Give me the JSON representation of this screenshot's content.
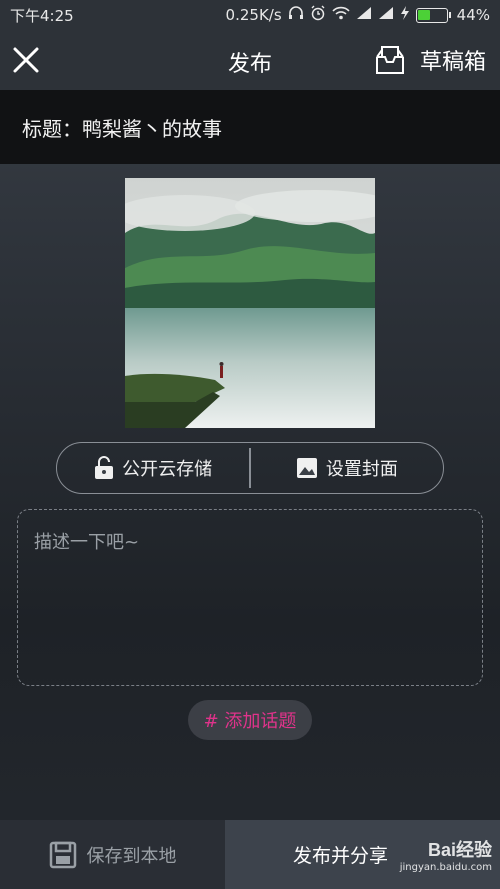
{
  "status_bar": {
    "time": "下午4:25",
    "speed": "0.25K/s",
    "battery_percent": "44%",
    "battery_level": 0.44,
    "icons": [
      "headphones-icon",
      "alarm-icon",
      "wifi-icon",
      "signal-icon",
      "signal-icon",
      "charging-icon",
      "battery-icon"
    ]
  },
  "header": {
    "title": "发布",
    "drafts_label": "草稿箱"
  },
  "post": {
    "title_text": "标题：鸭梨酱丶的故事"
  },
  "actions": {
    "public_storage_label": "公开云存储",
    "set_cover_label": "设置封面"
  },
  "description": {
    "placeholder": "描述一下吧~"
  },
  "topic": {
    "label": "# 添加话题"
  },
  "footer": {
    "save_local_label": "保存到本地",
    "publish_share_label": "发布并分享"
  },
  "watermark": {
    "logo": "Bai经验",
    "url": "jingyan.baidu.com"
  },
  "colors": {
    "accent_topic": "#e0338b",
    "battery_green": "#4cd137"
  }
}
